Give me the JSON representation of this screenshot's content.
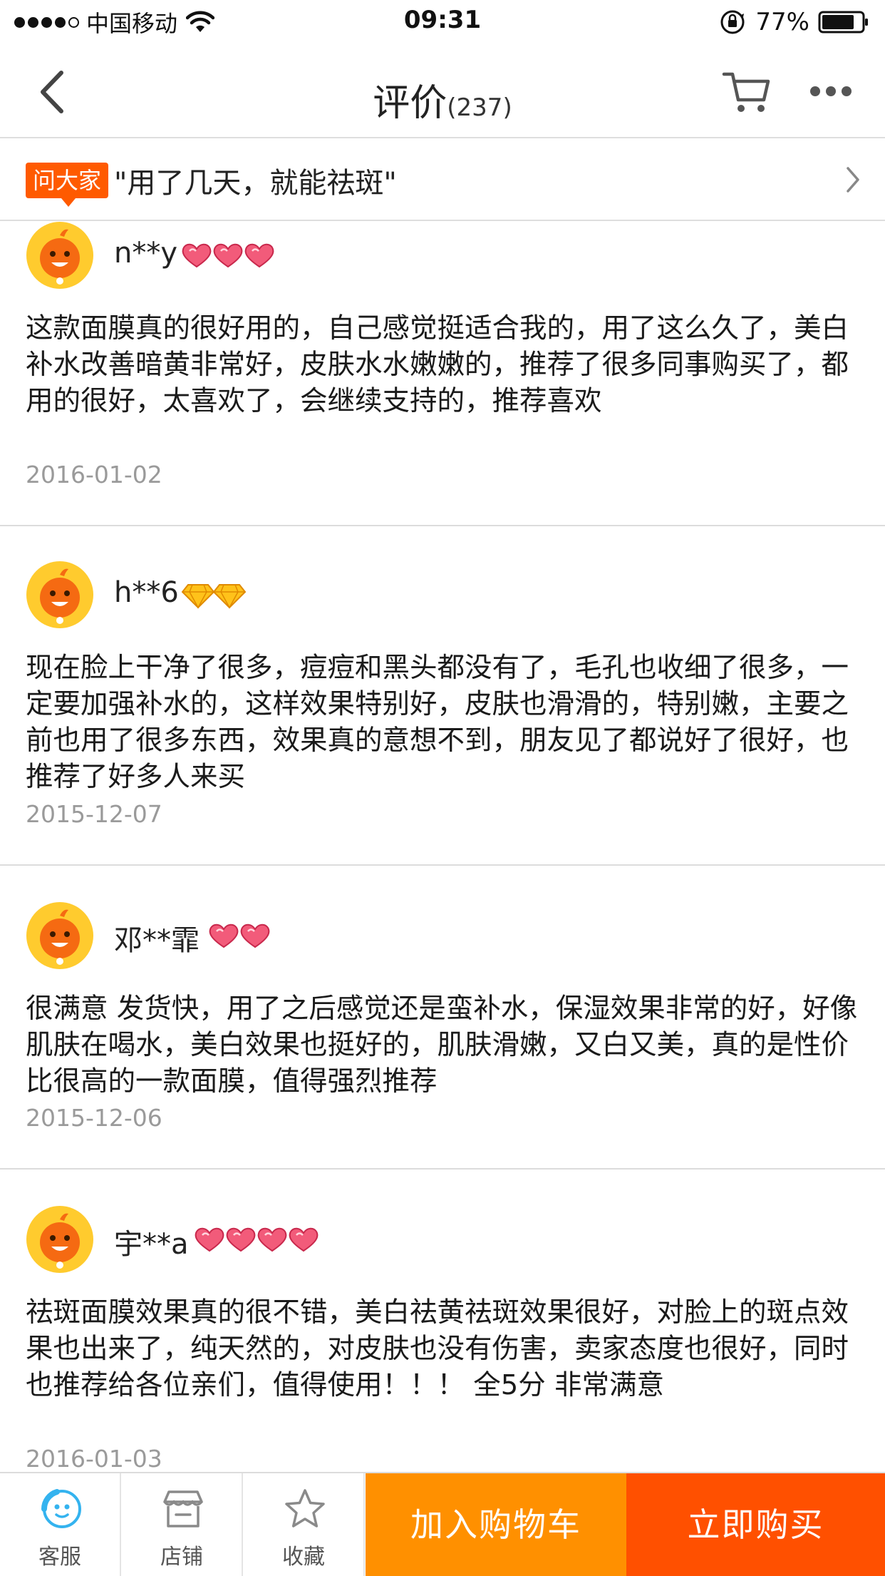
{
  "status_bar": {
    "carrier": "中国移动",
    "time": "09:31",
    "battery": "77%"
  },
  "nav": {
    "title": "评价",
    "count": "(237)"
  },
  "ask": {
    "badge": "问大家",
    "text": "\"用了几天，就能祛斑\""
  },
  "reviews": [
    {
      "name": "n**y",
      "level_icon": "heart-icon",
      "level_count": 3,
      "text": "这款面膜真的很好用的，自己感觉挺适合我的，用了这么久了，美白补水改善暗黄非常好，皮肤水水嫩嫩的，推荐了很多同事购买了，都用的很好，太喜欢了，会继续支持的，推荐喜欢",
      "date": "2016-01-02"
    },
    {
      "name": "h**6",
      "level_icon": "diamond-icon",
      "level_count": 2,
      "text": "现在脸上干净了很多，痘痘和黑头都没有了，毛孔也收细了很多，一定要加强补水的，这样效果特别好，皮肤也滑滑的，特别嫩，主要之前也用了很多东西，效果真的意想不到，朋友见了都说好了很好，也推荐了好多人来买",
      "date": "2015-12-07"
    },
    {
      "name": "邓**霏",
      "level_icon": "heart-icon",
      "level_count": 2,
      "text": "很满意 发货快，用了之后感觉还是蛮补水，保湿效果非常的好，好像肌肤在喝水，美白效果也挺好的，肌肤滑嫩，又白又美，真的是性价比很高的一款面膜，值得强烈推荐",
      "date": "2015-12-06"
    },
    {
      "name": "宇**a",
      "level_icon": "heart-icon",
      "level_count": 4,
      "text": "祛斑面膜效果真的很不错，美白祛黄祛斑效果很好，对脸上的斑点效果也出来了，纯天然的，对皮肤也没有伤害，卖家态度也很好，同时也推荐给各位亲们，值得使用！！！ 全5分 非常满意",
      "date": "2016-01-03"
    }
  ],
  "bottom_bar": {
    "service": "客服",
    "shop": "店铺",
    "favorite": "收藏",
    "add_to_cart": "加入购物车",
    "buy_now": "立即购买"
  },
  "colors": {
    "accent_orange": "#ff9000",
    "accent_red_orange": "#ff5000",
    "badge": "#ff5a00",
    "date_gray": "#9a9a9a"
  }
}
